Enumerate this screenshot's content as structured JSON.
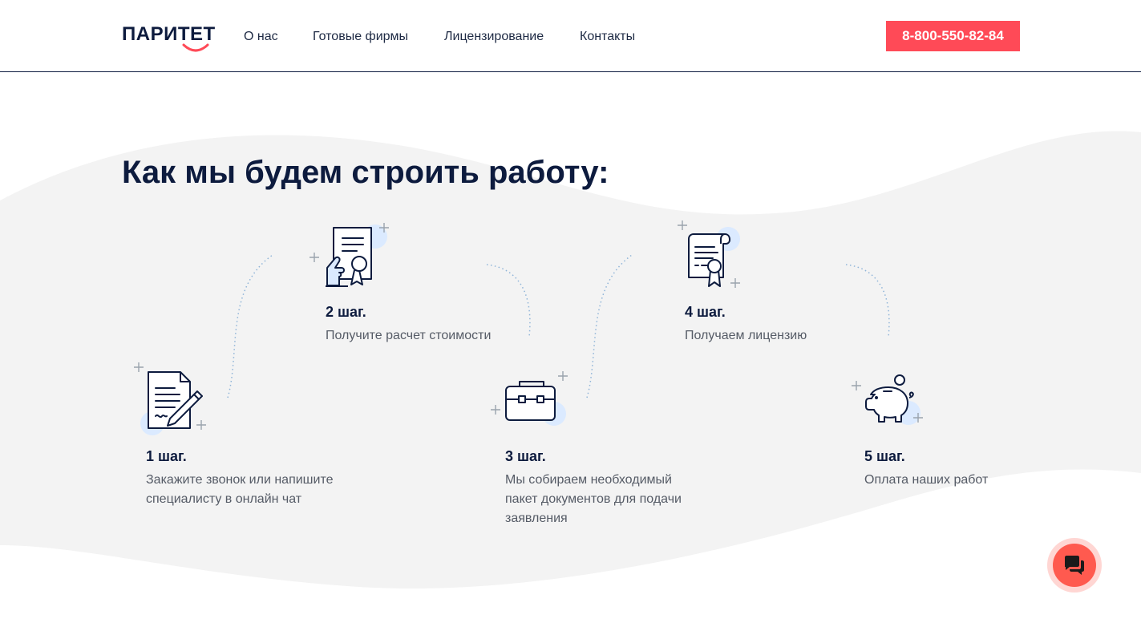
{
  "header": {
    "logo_text": "ПАРИТЕТ",
    "nav": [
      {
        "label": "О нас"
      },
      {
        "label": "Готовые фирмы"
      },
      {
        "label": "Лицензирование"
      },
      {
        "label": "Контакты"
      }
    ],
    "phone": "8-800-550-82-84"
  },
  "main": {
    "title": "Как мы будем строить работу:",
    "steps": [
      {
        "title": "1 шаг.",
        "text_lines": [
          "Закажите звонок или напишите",
          "специалисту в онлайн чат"
        ],
        "icon": "document-pen-icon"
      },
      {
        "title": "2 шаг.",
        "text_lines": [
          "Получите расчет стоимости"
        ],
        "icon": "certificate-hand-icon"
      },
      {
        "title": "3 шаг.",
        "text_lines": [
          "Мы собираем необходимый",
          "пакет документов для подачи",
          "заявления"
        ],
        "icon": "briefcase-icon"
      },
      {
        "title": "4 шаг.",
        "text_lines": [
          "Получаем лицензию"
        ],
        "icon": "license-scroll-icon"
      },
      {
        "title": "5 шаг.",
        "text_lines": [
          "Оплата наших работ"
        ],
        "icon": "piggy-bank-icon"
      }
    ]
  },
  "colors": {
    "brand_dark": "#0d1b3e",
    "accent_red": "#ff4a57",
    "bg_wave": "#f3f3f3",
    "icon_highlight": "#dbeaff"
  },
  "chat": {
    "icon": "chat-icon"
  }
}
